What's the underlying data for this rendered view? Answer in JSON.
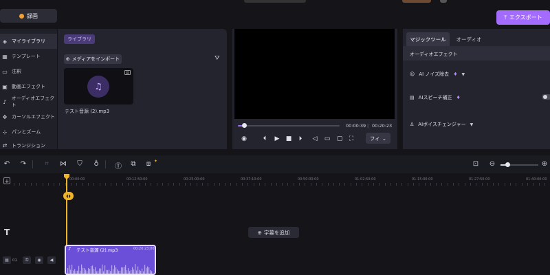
{
  "topbar": {
    "record_label": "録画",
    "export_label": "エクスポート"
  },
  "colors": {
    "accent": "#a36cff",
    "playhead": "#f0b429",
    "clip": "#6b4fd8",
    "record_dot": "#f0a13a"
  },
  "sidebar": {
    "items": [
      {
        "icon": "layers-icon",
        "label": "マイライブラリ",
        "active": true
      },
      {
        "icon": "template-icon",
        "label": "テンプレート"
      },
      {
        "icon": "annotation-icon",
        "label": "注釈"
      },
      {
        "icon": "video-effect-icon",
        "label": "動画エフェクト"
      },
      {
        "icon": "audio-effect-icon",
        "label": "オーディオエフェクト"
      },
      {
        "icon": "cursor-icon",
        "label": "カーソルエフェクト"
      },
      {
        "icon": "pan-zoom-icon",
        "label": "パンとズーム"
      },
      {
        "icon": "transition-icon",
        "label": "トランジション"
      }
    ]
  },
  "library": {
    "tab_label": "ライブラリ",
    "import_label": "メディアをインポート",
    "media": [
      {
        "name": "テスト音源 (2).mp3"
      }
    ]
  },
  "preview": {
    "current_time": "00:00:39",
    "separator": "|",
    "total_time": "00:20:23",
    "progress_fraction": 0.03,
    "fit_label": "フィ"
  },
  "right_panel": {
    "tabs": [
      "マジックツール",
      "オーディオ"
    ],
    "section_title": "オーディオエフェクト",
    "items": [
      {
        "label": "AI ノイズ除去"
      },
      {
        "label": "AIスピーチ補正"
      },
      {
        "label": "AIボイスチェンジャー"
      }
    ]
  },
  "timeline": {
    "ruler_labels": [
      "00:00:00",
      "00:12:50:00",
      "00:25:00:00",
      "00:37:10:00",
      "00:50:00:00",
      "01:02:50:00",
      "01:15:00:00",
      "01:27:50:00",
      "01:40:00:00"
    ],
    "playhead_label": "00:00",
    "add_caption_label": "字幕を追加",
    "track_number": "01",
    "clip": {
      "name": "テスト音源 (2).mp3",
      "duration": "00:20:23:00"
    },
    "zoom_fraction": 0.2
  }
}
